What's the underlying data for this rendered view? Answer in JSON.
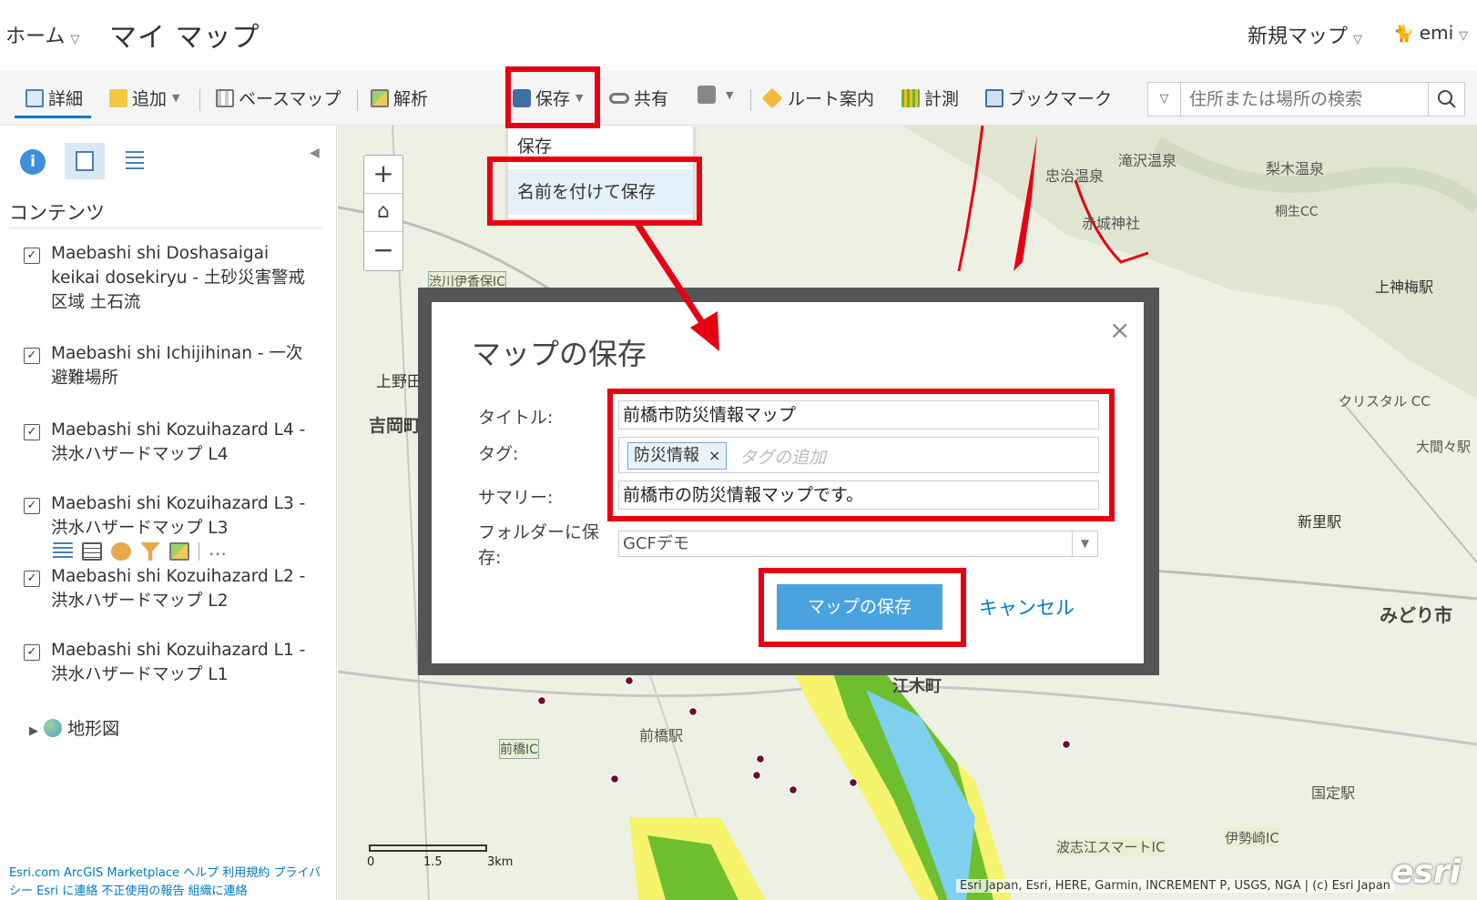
{
  "header": {
    "home_label": "ホーム",
    "app_title": "マイ マップ",
    "new_map_label": "新規マップ",
    "user_name": "emi"
  },
  "toolbar": {
    "details": "詳細",
    "add": "追加",
    "basemap": "ベースマップ",
    "analysis": "解析",
    "save": "保存",
    "share": "共有",
    "route": "ルート案内",
    "measure": "計測",
    "bookmarks": "ブックマーク",
    "search_placeholder": "住所または場所の検索"
  },
  "save_menu": {
    "items": [
      "保存",
      "名前を付けて保存"
    ],
    "highlighted": "名前を付けて保存"
  },
  "sidebar": {
    "contents_title": "コンテンツ",
    "layers": [
      {
        "label": "Maebashi shi Doshasaigai keikai dosekiryu - 土砂災害警戒区域 土石流",
        "checked": true
      },
      {
        "label": "Maebashi shi Ichijihinan - 一次避難場所",
        "checked": true
      },
      {
        "label": "Maebashi shi Kozuihazard L4 - 洪水ハザードマップ L4",
        "checked": true
      },
      {
        "label": "Maebashi shi Kozuihazard L3 - 洪水ハザードマップ L3",
        "checked": true
      },
      {
        "label": "Maebashi shi Kozuihazard L2 - 洪水ハザードマップ L2",
        "checked": true
      },
      {
        "label": "Maebashi shi Kozuihazard L1 - 洪水ハザードマップ L1",
        "checked": true
      }
    ],
    "basemap_layer": "地形図",
    "footer_links": "Esri.com ArcGIS Marketplace ヘルプ 利用規約 プライバシー Esri に連絡 不正使用の報告 組織に連絡"
  },
  "map": {
    "scale_labels": [
      "0",
      "1.5",
      "3km"
    ],
    "attribution": "Esri Japan, Esri, HERE, Garmin, INCREMENT P, USGS, NGA | (c) Esri Japan",
    "logo": "esri",
    "place_labels": {
      "shibukawa_ic": "渋川伊香保IC",
      "kamiyaba": "上野田",
      "yoshioka": "吉岡町",
      "takizawa": "滝沢温泉",
      "nashiki": "梨木温泉",
      "chuji": "忠治温泉",
      "akagi": "赤城神社",
      "kamiumeda": "上神梅駅",
      "shinsato": "新里駅",
      "midori": "みどり市",
      "maebashi_ic": "前橋IC",
      "maebashi_sta": "前橋駅",
      "etoki": "江木町",
      "kunisada": "国定駅",
      "hashie": "波志江スマートIC",
      "isesaki": "伊勢崎IC",
      "omama": "大間々駅",
      "crystal": "クリスタル CC",
      "kirifu": "桐生CC"
    }
  },
  "dialog": {
    "title": "マップの保存",
    "title_label": "タイトル:",
    "title_value": "前橋市防災情報マップ",
    "tags_label": "タグ:",
    "tag_chip": "防災情報",
    "tag_placeholder": "タグの追加",
    "summary_label": "サマリー:",
    "summary_value": "前橋市の防災情報マップです。",
    "folder_label_line1": "フォルダーに保",
    "folder_label_line2": "存:",
    "folder_value": "GCFデモ",
    "save_button": "マップの保存",
    "cancel_button": "キャンセル"
  },
  "colors": {
    "accent": "#0079c1",
    "save_button": "#4aa3df",
    "annotation_red": "#e60012"
  }
}
